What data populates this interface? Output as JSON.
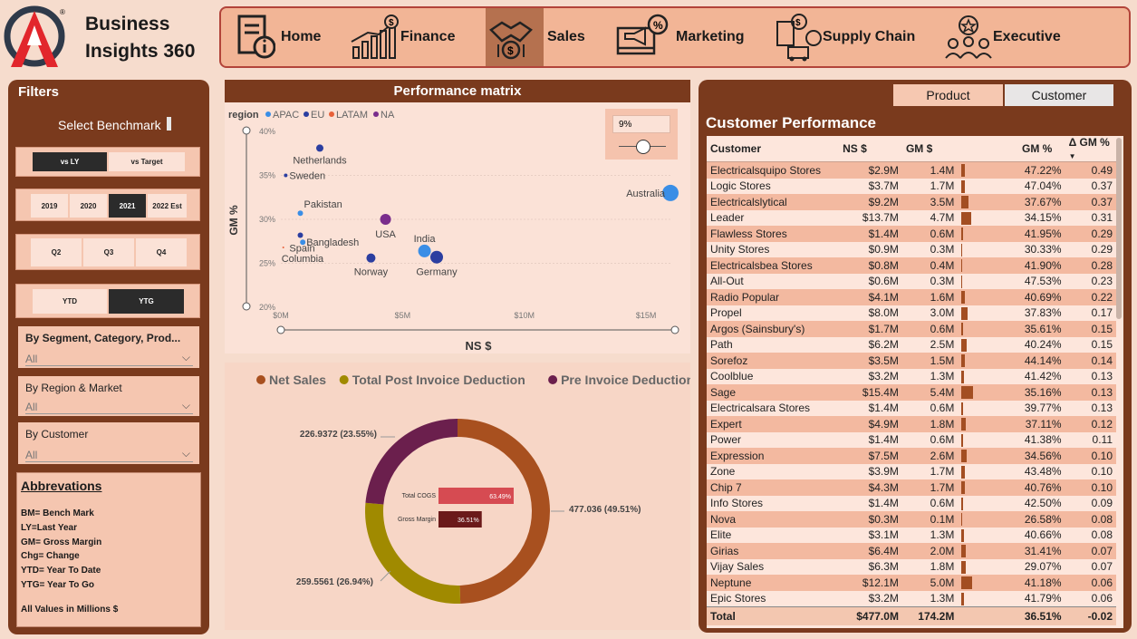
{
  "app": {
    "brand_line1": "Business",
    "brand_line2": "Insights 360",
    "registered": "®"
  },
  "nav": [
    {
      "label": "Home",
      "icon": "document-info-icon",
      "active": false
    },
    {
      "label": "Finance",
      "icon": "finance-chart-icon",
      "active": false
    },
    {
      "label": "Sales",
      "icon": "handshake-icon",
      "active": true
    },
    {
      "label": "Marketing",
      "icon": "megaphone-icon",
      "active": false
    },
    {
      "label": "Supply Chain",
      "icon": "truck-icon",
      "active": false
    },
    {
      "label": "Executive",
      "icon": "team-icon",
      "active": false
    }
  ],
  "filters": {
    "title": "Filters",
    "benchmark_label": "Select Benchmark",
    "benchmark": [
      "vs LY",
      "vs Target"
    ],
    "benchmark_selected": "vs LY",
    "years": [
      "2019",
      "2020",
      "2021",
      "2022 Est"
    ],
    "year_selected": "2021",
    "quarters": [
      "Q2",
      "Q3",
      "Q4"
    ],
    "ytd": [
      "YTD",
      "YTG"
    ],
    "ytd_selected": "YTG",
    "segment": {
      "label": "By Segment, Category, Prod...",
      "value": "All"
    },
    "region": {
      "label": "By Region & Market",
      "value": "All"
    },
    "customer": {
      "label": "By Customer",
      "value": "All"
    }
  },
  "abbreviations": {
    "title": "Abbrevations",
    "lines": [
      "BM= Bench Mark",
      "LY=Last Year",
      "GM= Gross Margin",
      "Chg= Change",
      "YTD= Year To Date",
      "YTG= Year To Go"
    ],
    "note": "All Values in Millions $"
  },
  "matrix": {
    "title": "Performance matrix",
    "legend_title": "region",
    "slider_value": "9%"
  },
  "chart_data": [
    {
      "type": "scatter",
      "title": "Performance matrix",
      "xlabel": "NS $",
      "ylabel": "GM %",
      "xlim": [
        0,
        16
      ],
      "ylim": [
        20,
        40
      ],
      "x_ticks": [
        "$0M",
        "$5M",
        "$10M",
        "$15M"
      ],
      "y_ticks": [
        "20%",
        "25%",
        "30%",
        "35%",
        "40%"
      ],
      "legend": [
        {
          "name": "APAC",
          "color": "#3a8ee6"
        },
        {
          "name": "EU",
          "color": "#2b3ea0"
        },
        {
          "name": "LATAM",
          "color": "#e8613a"
        },
        {
          "name": "NA",
          "color": "#7a2d8c"
        }
      ],
      "points": [
        {
          "label": "Netherlands",
          "x": 1.6,
          "y": 38.1,
          "region": "EU",
          "size": 4
        },
        {
          "label": "Sweden",
          "x": 0.2,
          "y": 35.0,
          "region": "EU",
          "size": 2
        },
        {
          "label": "Australia",
          "x": 16.0,
          "y": 33.0,
          "region": "APAC",
          "size": 9
        },
        {
          "label": "Pakistan",
          "x": 0.8,
          "y": 30.7,
          "region": "APAC",
          "size": 3
        },
        {
          "label": "USA",
          "x": 4.3,
          "y": 30.0,
          "region": "NA",
          "size": 6
        },
        {
          "label": "Spain",
          "x": 0.8,
          "y": 28.2,
          "region": "EU",
          "size": 3
        },
        {
          "label": "Bangladesh",
          "x": 0.9,
          "y": 27.4,
          "region": "APAC",
          "size": 3
        },
        {
          "label": "India",
          "x": 5.9,
          "y": 26.4,
          "region": "APAC",
          "size": 7
        },
        {
          "label": "Germany",
          "x": 6.4,
          "y": 25.7,
          "region": "EU",
          "size": 7
        },
        {
          "label": "Norway",
          "x": 3.7,
          "y": 25.6,
          "region": "EU",
          "size": 5
        },
        {
          "label": "Columbia",
          "x": 0.1,
          "y": 26.8,
          "region": "LATAM",
          "size": 1
        }
      ]
    },
    {
      "type": "pie",
      "legend": [
        "Net Sales",
        "Total Post Invoice Deduction",
        "Pre Invoice Deduction"
      ],
      "colors": [
        "#a8501f",
        "#a08a00",
        "#6b1f4d"
      ],
      "slices": [
        {
          "name": "Net Sales",
          "value": 477.036,
          "pct": 49.51,
          "label": "477.036 (49.51%)"
        },
        {
          "name": "Total Post Invoice Deduction",
          "value": 259.5561,
          "pct": 26.94,
          "label": "259.5561 (26.94%)"
        },
        {
          "name": "Pre Invoice Deduction",
          "value": 226.9372,
          "pct": 23.55,
          "label": "226.9372 (23.55%)"
        }
      ],
      "inner_bars": [
        {
          "label": "Total COGS",
          "value": 63.49,
          "text": "63.49%",
          "color": "#d64b52"
        },
        {
          "label": "Gross Margin",
          "value": 36.51,
          "text": "36.51%",
          "color": "#6b1a1a"
        }
      ]
    }
  ],
  "customer_table": {
    "tabs": [
      "Product",
      "Customer"
    ],
    "title": "Customer Performance",
    "columns": [
      "Customer",
      "NS $",
      "GM $",
      "",
      "GM %",
      "Δ GM %"
    ],
    "rows": [
      {
        "name": "Electricalsquipo Stores",
        "ns": "$2.9M",
        "gm": "1.4M",
        "gmv": 1.4,
        "gmp": "47.22%",
        "dgm": "0.49"
      },
      {
        "name": "Logic Stores",
        "ns": "$3.7M",
        "gm": "1.7M",
        "gmv": 1.7,
        "gmp": "47.04%",
        "dgm": "0.37"
      },
      {
        "name": "Electricalslytical",
        "ns": "$9.2M",
        "gm": "3.5M",
        "gmv": 3.5,
        "gmp": "37.67%",
        "dgm": "0.37"
      },
      {
        "name": "Leader",
        "ns": "$13.7M",
        "gm": "4.7M",
        "gmv": 4.7,
        "gmp": "34.15%",
        "dgm": "0.31"
      },
      {
        "name": "Flawless Stores",
        "ns": "$1.4M",
        "gm": "0.6M",
        "gmv": 0.6,
        "gmp": "41.95%",
        "dgm": "0.29"
      },
      {
        "name": "Unity Stores",
        "ns": "$0.9M",
        "gm": "0.3M",
        "gmv": 0.3,
        "gmp": "30.33%",
        "dgm": "0.29"
      },
      {
        "name": "Electricalsbea Stores",
        "ns": "$0.8M",
        "gm": "0.4M",
        "gmv": 0.4,
        "gmp": "41.90%",
        "dgm": "0.28"
      },
      {
        "name": "All-Out",
        "ns": "$0.6M",
        "gm": "0.3M",
        "gmv": 0.3,
        "gmp": "47.53%",
        "dgm": "0.23"
      },
      {
        "name": "Radio Popular",
        "ns": "$4.1M",
        "gm": "1.6M",
        "gmv": 1.6,
        "gmp": "40.69%",
        "dgm": "0.22"
      },
      {
        "name": "Propel",
        "ns": "$8.0M",
        "gm": "3.0M",
        "gmv": 3.0,
        "gmp": "37.83%",
        "dgm": "0.17"
      },
      {
        "name": "Argos (Sainsbury's)",
        "ns": "$1.7M",
        "gm": "0.6M",
        "gmv": 0.6,
        "gmp": "35.61%",
        "dgm": "0.15"
      },
      {
        "name": "Path",
        "ns": "$6.2M",
        "gm": "2.5M",
        "gmv": 2.5,
        "gmp": "40.24%",
        "dgm": "0.15"
      },
      {
        "name": "Sorefoz",
        "ns": "$3.5M",
        "gm": "1.5M",
        "gmv": 1.5,
        "gmp": "44.14%",
        "dgm": "0.14"
      },
      {
        "name": "Coolblue",
        "ns": "$3.2M",
        "gm": "1.3M",
        "gmv": 1.3,
        "gmp": "41.42%",
        "dgm": "0.13"
      },
      {
        "name": "Sage",
        "ns": "$15.4M",
        "gm": "5.4M",
        "gmv": 5.4,
        "gmp": "35.16%",
        "dgm": "0.13"
      },
      {
        "name": "Electricalsara Stores",
        "ns": "$1.4M",
        "gm": "0.6M",
        "gmv": 0.6,
        "gmp": "39.77%",
        "dgm": "0.13"
      },
      {
        "name": "Expert",
        "ns": "$4.9M",
        "gm": "1.8M",
        "gmv": 1.8,
        "gmp": "37.11%",
        "dgm": "0.12"
      },
      {
        "name": "Power",
        "ns": "$1.4M",
        "gm": "0.6M",
        "gmv": 0.6,
        "gmp": "41.38%",
        "dgm": "0.11"
      },
      {
        "name": "Expression",
        "ns": "$7.5M",
        "gm": "2.6M",
        "gmv": 2.6,
        "gmp": "34.56%",
        "dgm": "0.10"
      },
      {
        "name": "Zone",
        "ns": "$3.9M",
        "gm": "1.7M",
        "gmv": 1.7,
        "gmp": "43.48%",
        "dgm": "0.10"
      },
      {
        "name": "Chip 7",
        "ns": "$4.3M",
        "gm": "1.7M",
        "gmv": 1.7,
        "gmp": "40.76%",
        "dgm": "0.10"
      },
      {
        "name": "Info Stores",
        "ns": "$1.4M",
        "gm": "0.6M",
        "gmv": 0.6,
        "gmp": "42.50%",
        "dgm": "0.09"
      },
      {
        "name": "Nova",
        "ns": "$0.3M",
        "gm": "0.1M",
        "gmv": 0.1,
        "gmp": "26.58%",
        "dgm": "0.08"
      },
      {
        "name": "Elite",
        "ns": "$3.1M",
        "gm": "1.3M",
        "gmv": 1.3,
        "gmp": "40.66%",
        "dgm": "0.08"
      },
      {
        "name": "Girias",
        "ns": "$6.4M",
        "gm": "2.0M",
        "gmv": 2.0,
        "gmp": "31.41%",
        "dgm": "0.07"
      },
      {
        "name": "Vijay Sales",
        "ns": "$6.3M",
        "gm": "1.8M",
        "gmv": 1.8,
        "gmp": "29.07%",
        "dgm": "0.07"
      },
      {
        "name": "Neptune",
        "ns": "$12.1M",
        "gm": "5.0M",
        "gmv": 5.0,
        "gmp": "41.18%",
        "dgm": "0.06"
      },
      {
        "name": "Epic Stores",
        "ns": "$3.2M",
        "gm": "1.3M",
        "gmv": 1.3,
        "gmp": "41.79%",
        "dgm": "0.06"
      }
    ],
    "total": {
      "name": "Total",
      "ns": "$477.0M",
      "gm": "174.2M",
      "gmp": "36.51%",
      "dgm": "-0.02"
    }
  }
}
